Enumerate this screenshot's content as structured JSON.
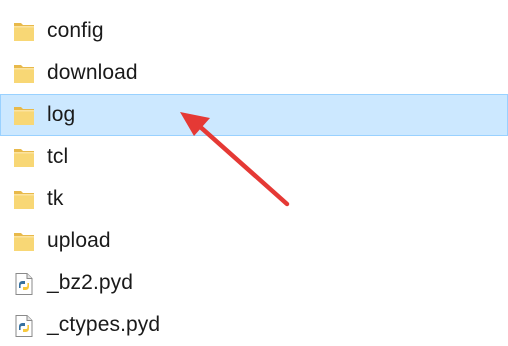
{
  "files": [
    {
      "name": "config",
      "type": "folder",
      "icon": "folder-icon",
      "selected": false
    },
    {
      "name": "download",
      "type": "folder",
      "icon": "folder-icon",
      "selected": false
    },
    {
      "name": "log",
      "type": "folder",
      "icon": "folder-icon",
      "selected": true
    },
    {
      "name": "tcl",
      "type": "folder",
      "icon": "folder-icon",
      "selected": false
    },
    {
      "name": "tk",
      "type": "folder",
      "icon": "folder-icon",
      "selected": false
    },
    {
      "name": "upload",
      "type": "folder",
      "icon": "folder-icon",
      "selected": false
    },
    {
      "name": "_bz2.pyd",
      "type": "python-extension",
      "icon": "python-file-icon",
      "selected": false
    },
    {
      "name": "_ctypes.pyd",
      "type": "python-extension",
      "icon": "python-file-icon",
      "selected": false
    }
  ],
  "colors": {
    "selection_bg": "#cce8ff",
    "selection_border": "#99d1ff",
    "folder_fill": "#f8d775",
    "folder_dark": "#e8b94a",
    "arrow": "#e53935"
  },
  "annotation": {
    "icon": "red-arrow-icon",
    "points_to": "log"
  }
}
